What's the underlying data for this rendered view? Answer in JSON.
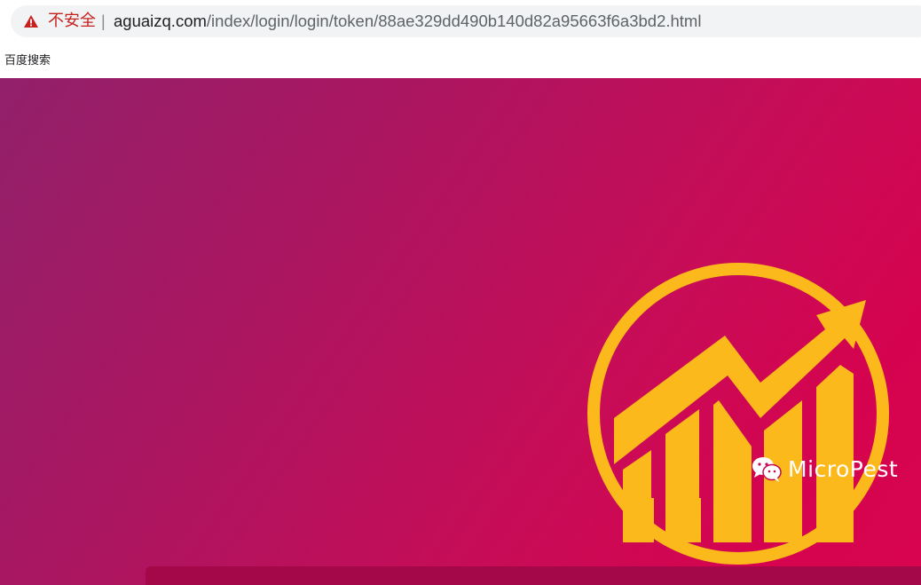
{
  "browser": {
    "security_label": "不安全",
    "separator": "|",
    "url_host": "aguaizq.com",
    "url_path": "/index/login/login/token/88ae329dd490b140d82a95663f6a3bd2.html",
    "bookmarks": [
      {
        "label": "百度搜索"
      }
    ]
  },
  "page": {
    "logo_icon": "growth-chart-logo-icon",
    "watermark": {
      "icon": "wechat-icon",
      "text": "MicroPest"
    }
  },
  "colors": {
    "gradient_start": "#92206a",
    "gradient_end": "#d8044f",
    "logo": "#fbb91b",
    "warning": "#c5221f"
  }
}
